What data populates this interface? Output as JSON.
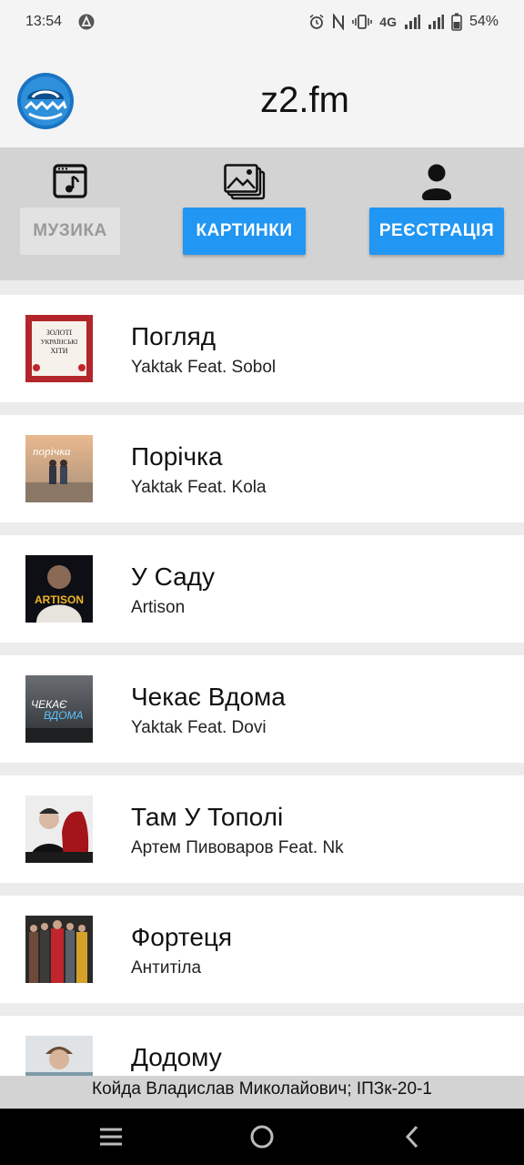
{
  "status_bar": {
    "time": "13:54",
    "network": "4G",
    "battery": "54%"
  },
  "header": {
    "title": "z2.fm"
  },
  "nav": {
    "music_label": "МУЗИКА",
    "pictures_label": "КАРТИНКИ",
    "register_label": "РЕЄСТРАЦІЯ"
  },
  "songs": [
    {
      "title": "Погляд",
      "artist": "Yaktak Feat. Sobol"
    },
    {
      "title": "Порічка",
      "artist": "Yaktak Feat. Kola"
    },
    {
      "title": "У Саду",
      "artist": "Artison"
    },
    {
      "title": "Чекає Вдома",
      "artist": "Yaktak Feat. Dovi"
    },
    {
      "title": "Там У Тополі",
      "artist": "Артем Пивоваров Feat. Nk"
    },
    {
      "title": "Фортеця",
      "artist": "Антитіла"
    },
    {
      "title": "Додому",
      "artist": ""
    }
  ],
  "covers": {
    "cover1_lines": [
      "ЗОЛОТІ",
      "УКРАЇНСЬКІ",
      "ХІТИ"
    ],
    "cover2_text": "порічка",
    "cover3_text": "ARTISON",
    "cover4_lines": [
      "ЧЕКАЄ",
      "ВДОМА"
    ]
  },
  "footer": {
    "text": "Койда Владислав Миколайович; ІПЗк-20-1"
  },
  "colors": {
    "accent": "#2196f3",
    "panel": "#d3d3d3"
  }
}
